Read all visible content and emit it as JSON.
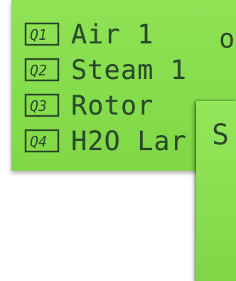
{
  "lcd": {
    "items": [
      {
        "icon": "Q1",
        "label": "Air 1",
        "status": "o"
      },
      {
        "icon": "Q2",
        "label": "Steam 1"
      },
      {
        "icon": "Q3",
        "label": "Rotor"
      },
      {
        "icon": "Q4",
        "label": "H2O Lar"
      }
    ],
    "colors": {
      "background": "#86dd4c",
      "text": "#2b4a2b"
    }
  },
  "popup": {
    "visible_text": "S"
  }
}
